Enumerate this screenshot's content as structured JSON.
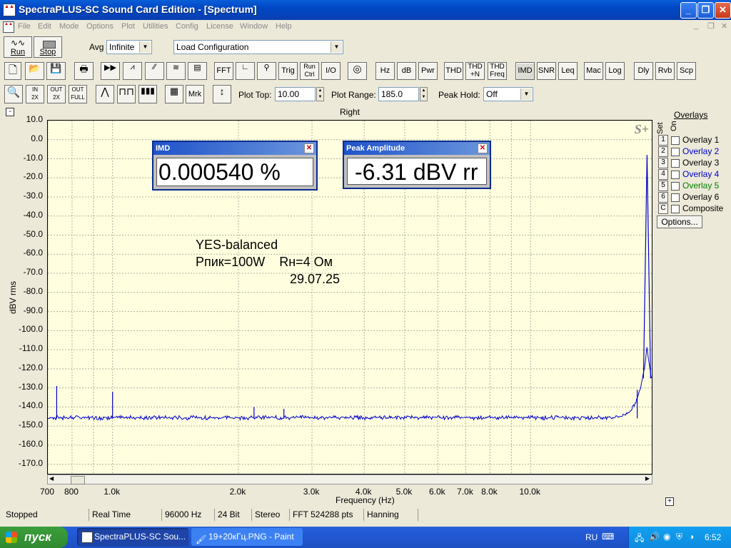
{
  "window": {
    "title": "SpectraPLUS-SC Sound Card Edition - [Spectrum]"
  },
  "menu": [
    "File",
    "Edit",
    "Mode",
    "Options",
    "Plot",
    "Utilities",
    "Config",
    "License",
    "Window",
    "Help"
  ],
  "toolbar1": {
    "run": "Run",
    "stop": "Stop",
    "avg_label": "Avg",
    "avg_value": "Infinite",
    "config_value": "Load Configuration"
  },
  "toolbar2": [
    "FFT",
    "Trig",
    "Run Ctrl",
    "I/O",
    "Hz",
    "dB",
    "Pwr",
    "THD",
    "THD +N",
    "THD Freq",
    "IMD",
    "SNR",
    "Leq",
    "Mac",
    "Log",
    "Dly",
    "Rvb",
    "Scp"
  ],
  "toolbar3": {
    "mrk": "Mrk",
    "plot_top_label": "Plot Top:",
    "plot_top_value": "10.00",
    "plot_range_label": "Plot Range:",
    "plot_range_value": "185.0",
    "peak_hold_label": "Peak Hold:",
    "peak_hold_value": "Off"
  },
  "plot": {
    "channel": "Right",
    "logo": "S+"
  },
  "mini_windows": {
    "imd": {
      "title": "IMD",
      "value": "0.000540 %"
    },
    "peak": {
      "title": "Peak Amplitude",
      "value": "-6.31 dBV rr"
    }
  },
  "annotation": {
    "line1": "YES-balanced",
    "line2": "Рпик=100W    Rн=4 Ом",
    "line3": "29.07.25"
  },
  "overlays": {
    "title": "Overlays",
    "set_label": "Set",
    "on_label": "On",
    "items": [
      {
        "num": "1",
        "name": "Overlay 1",
        "color": "#000000"
      },
      {
        "num": "2",
        "name": "Overlay 2",
        "color": "#0000cc"
      },
      {
        "num": "3",
        "name": "Overlay 3",
        "color": "#000000"
      },
      {
        "num": "4",
        "name": "Overlay 4",
        "color": "#0000cc"
      },
      {
        "num": "5",
        "name": "Overlay 5",
        "color": "#008000"
      },
      {
        "num": "6",
        "name": "Overlay 6",
        "color": "#000000"
      },
      {
        "num": "C",
        "name": "Composite",
        "color": "#000000"
      }
    ],
    "options": "Options..."
  },
  "status": [
    "Stopped",
    "Real Time",
    "96000 Hz",
    "24 Bit",
    "Stereo",
    "FFT 524288 pts",
    "Hanning"
  ],
  "taskbar": {
    "start": "пуск",
    "tasks": [
      "SpectraPLUS-SC Sou...",
      "19+20кГц.PNG - Paint"
    ],
    "lang": "RU",
    "clock": "6:52"
  },
  "chart_data": {
    "type": "line",
    "xlabel": "Frequency (Hz)",
    "ylabel": "dBV rms",
    "x_scale": "log",
    "xlim": [
      700,
      19500
    ],
    "ylim": [
      -175,
      10
    ],
    "y_ticks": [
      10,
      0,
      -10,
      -20,
      -30,
      -40,
      -50,
      -60,
      -70,
      -80,
      -90,
      -100,
      -110,
      -120,
      -130,
      -140,
      -150,
      -160,
      -170
    ],
    "y_tick_labels": [
      "10.0",
      "0.0",
      "-10.0",
      "-20.0",
      "-30.0",
      "-40.0",
      "-50.0",
      "-60.0",
      "-70.0",
      "-80.0",
      "-90.0",
      "-100.0",
      "-110.0",
      "-120.0",
      "-130.0",
      "-140.0",
      "-150.0",
      "-160.0",
      "-170.0"
    ],
    "x_ticks": [
      700,
      800,
      1000,
      2000,
      3000,
      4000,
      5000,
      6000,
      7000,
      8000,
      10000
    ],
    "x_tick_labels": [
      "700",
      "800",
      "1.0k",
      "2.0k",
      "3.0k",
      "4.0k",
      "5.0k",
      "6.0k",
      "7.0k",
      "8.0k",
      "10.0k"
    ],
    "grid": true,
    "noise_floor": -146,
    "series_color": "#0000cc",
    "peaks": [
      {
        "x": 735,
        "y": -129
      },
      {
        "x": 1000,
        "y": -132
      },
      {
        "x": 2180,
        "y": -140
      },
      {
        "x": 2570,
        "y": -141
      },
      {
        "x": 18000,
        "y": -131
      }
    ],
    "main_tones": [
      {
        "x": 19000,
        "y": -8
      },
      {
        "x": 20000,
        "y": -7
      }
    ]
  }
}
